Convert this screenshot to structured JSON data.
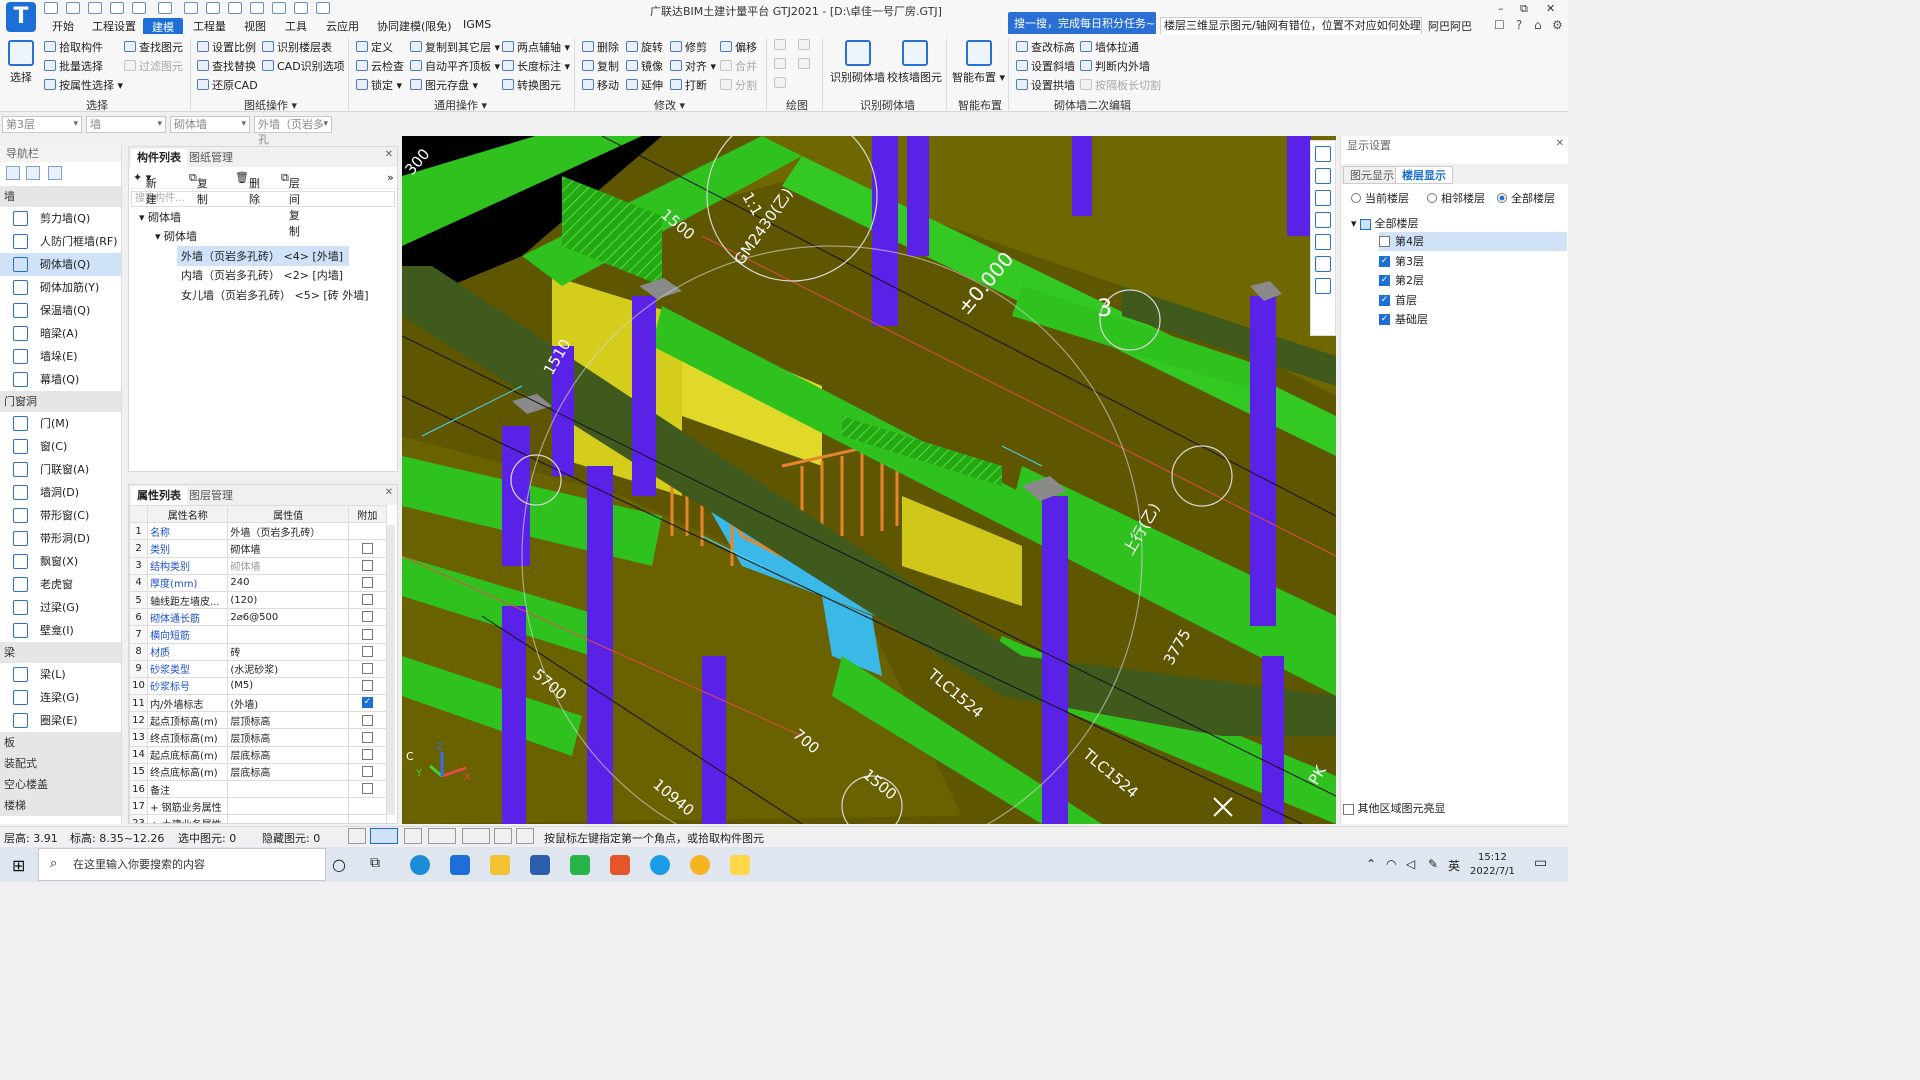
{
  "app": {
    "logo_letter": "T",
    "title": "广联达BIM土建计量平台 GTJ2021 - [D:\\卓佳一号厂房.GTJ]",
    "promo": "搜一搜，完成每日积分任务~",
    "search_text": "楼层三维显示图元/轴网有错位，位置不对应如何处理?",
    "user": "阿巴阿巴"
  },
  "menu": [
    "开始",
    "工程设置",
    "建模",
    "工程量",
    "视图",
    "工具",
    "云应用",
    "协同建模(限免)",
    "IGMS"
  ],
  "ribbon": {
    "select": {
      "big": "选择",
      "items": [
        "拾取构件",
        "批量选择",
        "按属性选择",
        "查找图元",
        "过滤图元"
      ],
      "title": "选择"
    },
    "drawing": {
      "items": [
        "设置比例",
        "识别楼层表",
        "查找替换",
        "CAD识别选项",
        "还原CAD"
      ],
      "title": "图纸操作"
    },
    "common": {
      "items": [
        "定义",
        "复制到其它层",
        "两点辅轴",
        "云检查",
        "自动平齐顶板",
        "长度标注",
        "锁定",
        "图元存盘",
        "转换图元"
      ],
      "title": "通用操作"
    },
    "modify": {
      "items": [
        "删除",
        "旋转",
        "修剪",
        "偏移",
        "复制",
        "镜像",
        "对齐",
        "合并",
        "移动",
        "延伸",
        "打断",
        "分割"
      ],
      "title": "修改"
    },
    "draw": {
      "title": "绘图"
    },
    "recognize": {
      "items": [
        "识别砌体墙",
        "校核墙图元"
      ],
      "title": "识别砌体墙"
    },
    "smart": {
      "items": [
        "智能布置"
      ],
      "title": "智能布置"
    },
    "secondary": {
      "items": [
        "查改标高",
        "墙体拉通",
        "设置斜墙",
        "判断内外墙",
        "设置拱墙",
        "按隔板长切割"
      ],
      "title": "砌体墙二次编辑"
    }
  },
  "dropdowns": [
    "第3层",
    "墙",
    "砌体墙",
    "外墙（页岩多孔"
  ],
  "nav": {
    "title": "导航栏",
    "categories": [
      {
        "name": "墙",
        "items": [
          "剪力墙(Q)",
          "人防门框墙(RF)",
          "砌体墙(Q)",
          "砌体加筋(Y)",
          "保温墙(Q)",
          "暗梁(A)",
          "墙垛(E)",
          "幕墙(Q)"
        ]
      },
      {
        "name": "门窗洞",
        "items": [
          "门(M)",
          "窗(C)",
          "门联窗(A)",
          "墙洞(D)",
          "带形窗(C)",
          "带形洞(D)",
          "飘窗(X)",
          "老虎窗",
          "过梁(G)",
          "壁龛(I)"
        ]
      },
      {
        "name": "梁",
        "items": [
          "梁(L)",
          "连梁(G)",
          "圈梁(E)"
        ]
      }
    ],
    "more_categories": [
      "板",
      "装配式",
      "空心楼盖",
      "楼梯"
    ],
    "selected": "砌体墙(Q)"
  },
  "component_list": {
    "tabs": [
      "构件列表",
      "图纸管理"
    ],
    "tools": [
      "新建",
      "复制",
      "删除",
      "层间复制"
    ],
    "search_placeholder": "搜索构件...",
    "tree": {
      "root": "砌体墙",
      "child": "砌体墙",
      "items": [
        "外墙（页岩多孔砖） <4> [外墙]",
        "内墙（页岩多孔砖） <2> [内墙]",
        "女儿墙（页岩多孔砖） <5> [砖 外墙]"
      ]
    }
  },
  "properties": {
    "tabs": [
      "属性列表",
      "图层管理"
    ],
    "headers": [
      "属性名称",
      "属性值",
      "附加"
    ],
    "rows": [
      {
        "n": "1",
        "name": "名称",
        "value": "外墙（页岩多孔砖）",
        "blue": true,
        "checked": null
      },
      {
        "n": "2",
        "name": "类别",
        "value": "砌体墙",
        "blue": true,
        "checked": false
      },
      {
        "n": "3",
        "name": "结构类别",
        "value": "砌体墙",
        "blue": true,
        "gray": true,
        "checked": false
      },
      {
        "n": "4",
        "name": "厚度(mm)",
        "value": "240",
        "blue": true,
        "checked": false
      },
      {
        "n": "5",
        "name": "轴线距左墙皮...",
        "value": "(120)",
        "checked": false
      },
      {
        "n": "6",
        "name": "砌体通长筋",
        "value": "2⌀6@500",
        "blue": true,
        "checked": false
      },
      {
        "n": "7",
        "name": "横向短筋",
        "value": "",
        "blue": true,
        "checked": false
      },
      {
        "n": "8",
        "name": "材质",
        "value": "砖",
        "blue": true,
        "checked": false
      },
      {
        "n": "9",
        "name": "砂浆类型",
        "value": "(水泥砂浆)",
        "blue": true,
        "checked": false
      },
      {
        "n": "10",
        "name": "砂浆标号",
        "value": "(M5)",
        "blue": true,
        "checked": false
      },
      {
        "n": "11",
        "name": "内/外墙标志",
        "value": "(外墙)",
        "checked": true
      },
      {
        "n": "12",
        "name": "起点顶标高(m)",
        "value": "层顶标高",
        "checked": false
      },
      {
        "n": "13",
        "name": "终点顶标高(m)",
        "value": "层顶标高",
        "checked": false
      },
      {
        "n": "14",
        "name": "起点底标高(m)",
        "value": "层底标高",
        "checked": false
      },
      {
        "n": "15",
        "name": "终点底标高(m)",
        "value": "层底标高",
        "checked": false
      },
      {
        "n": "16",
        "name": "备注",
        "value": "",
        "checked": false
      },
      {
        "n": "17",
        "name": "+ 钢筋业务属性",
        "value": "",
        "checked": null
      },
      {
        "n": "23",
        "name": "+ 土建业务属性",
        "value": "",
        "checked": null
      }
    ]
  },
  "viewport": {
    "labels": [
      "300",
      "1500",
      "GM2430(乙)",
      "±0.000",
      "1510",
      "3",
      "上行(乙)",
      "1:1",
      "3775",
      "TLC1524",
      "TLC1524",
      "700",
      "1500",
      "10940",
      "5700",
      "PK"
    ],
    "axis": {
      "x": "X",
      "y": "Y",
      "z": "Z",
      "c": "C"
    }
  },
  "display": {
    "title": "显示设置",
    "tabs": [
      "图元显示",
      "楼层显示"
    ],
    "radios": [
      {
        "label": "当前楼层",
        "on": false
      },
      {
        "label": "相邻楼层",
        "on": false
      },
      {
        "label": "全部楼层",
        "on": true
      }
    ],
    "root": "全部楼层",
    "floors": [
      {
        "label": "第4层",
        "checked": false
      },
      {
        "label": "第3层",
        "checked": true
      },
      {
        "label": "第2层",
        "checked": true
      },
      {
        "label": "首层",
        "checked": true
      },
      {
        "label": "基础层",
        "checked": true
      }
    ],
    "footer": "其他区域图元亮显"
  },
  "status": {
    "floor_height": "层高:  3.91",
    "elevation": "标高:  8.35~12.26",
    "selected": "选中图元:  0",
    "hidden": "隐藏图元:  0",
    "hint": "按鼠标左键指定第一个角点，或拾取构件图元"
  },
  "taskbar": {
    "search": "在这里输入你要搜索的内容",
    "ime": "英",
    "time": "15:12",
    "date": "2022/7/1"
  },
  "colors": {
    "accent": "#1b6fd6",
    "wall_green": "#2fc11e",
    "column_purple": "#5a22e6",
    "floor_olive": "#6b6300",
    "yellow": "#d9d21e",
    "cyan": "#3ab9e6",
    "stair_orange": "#e8842a"
  }
}
